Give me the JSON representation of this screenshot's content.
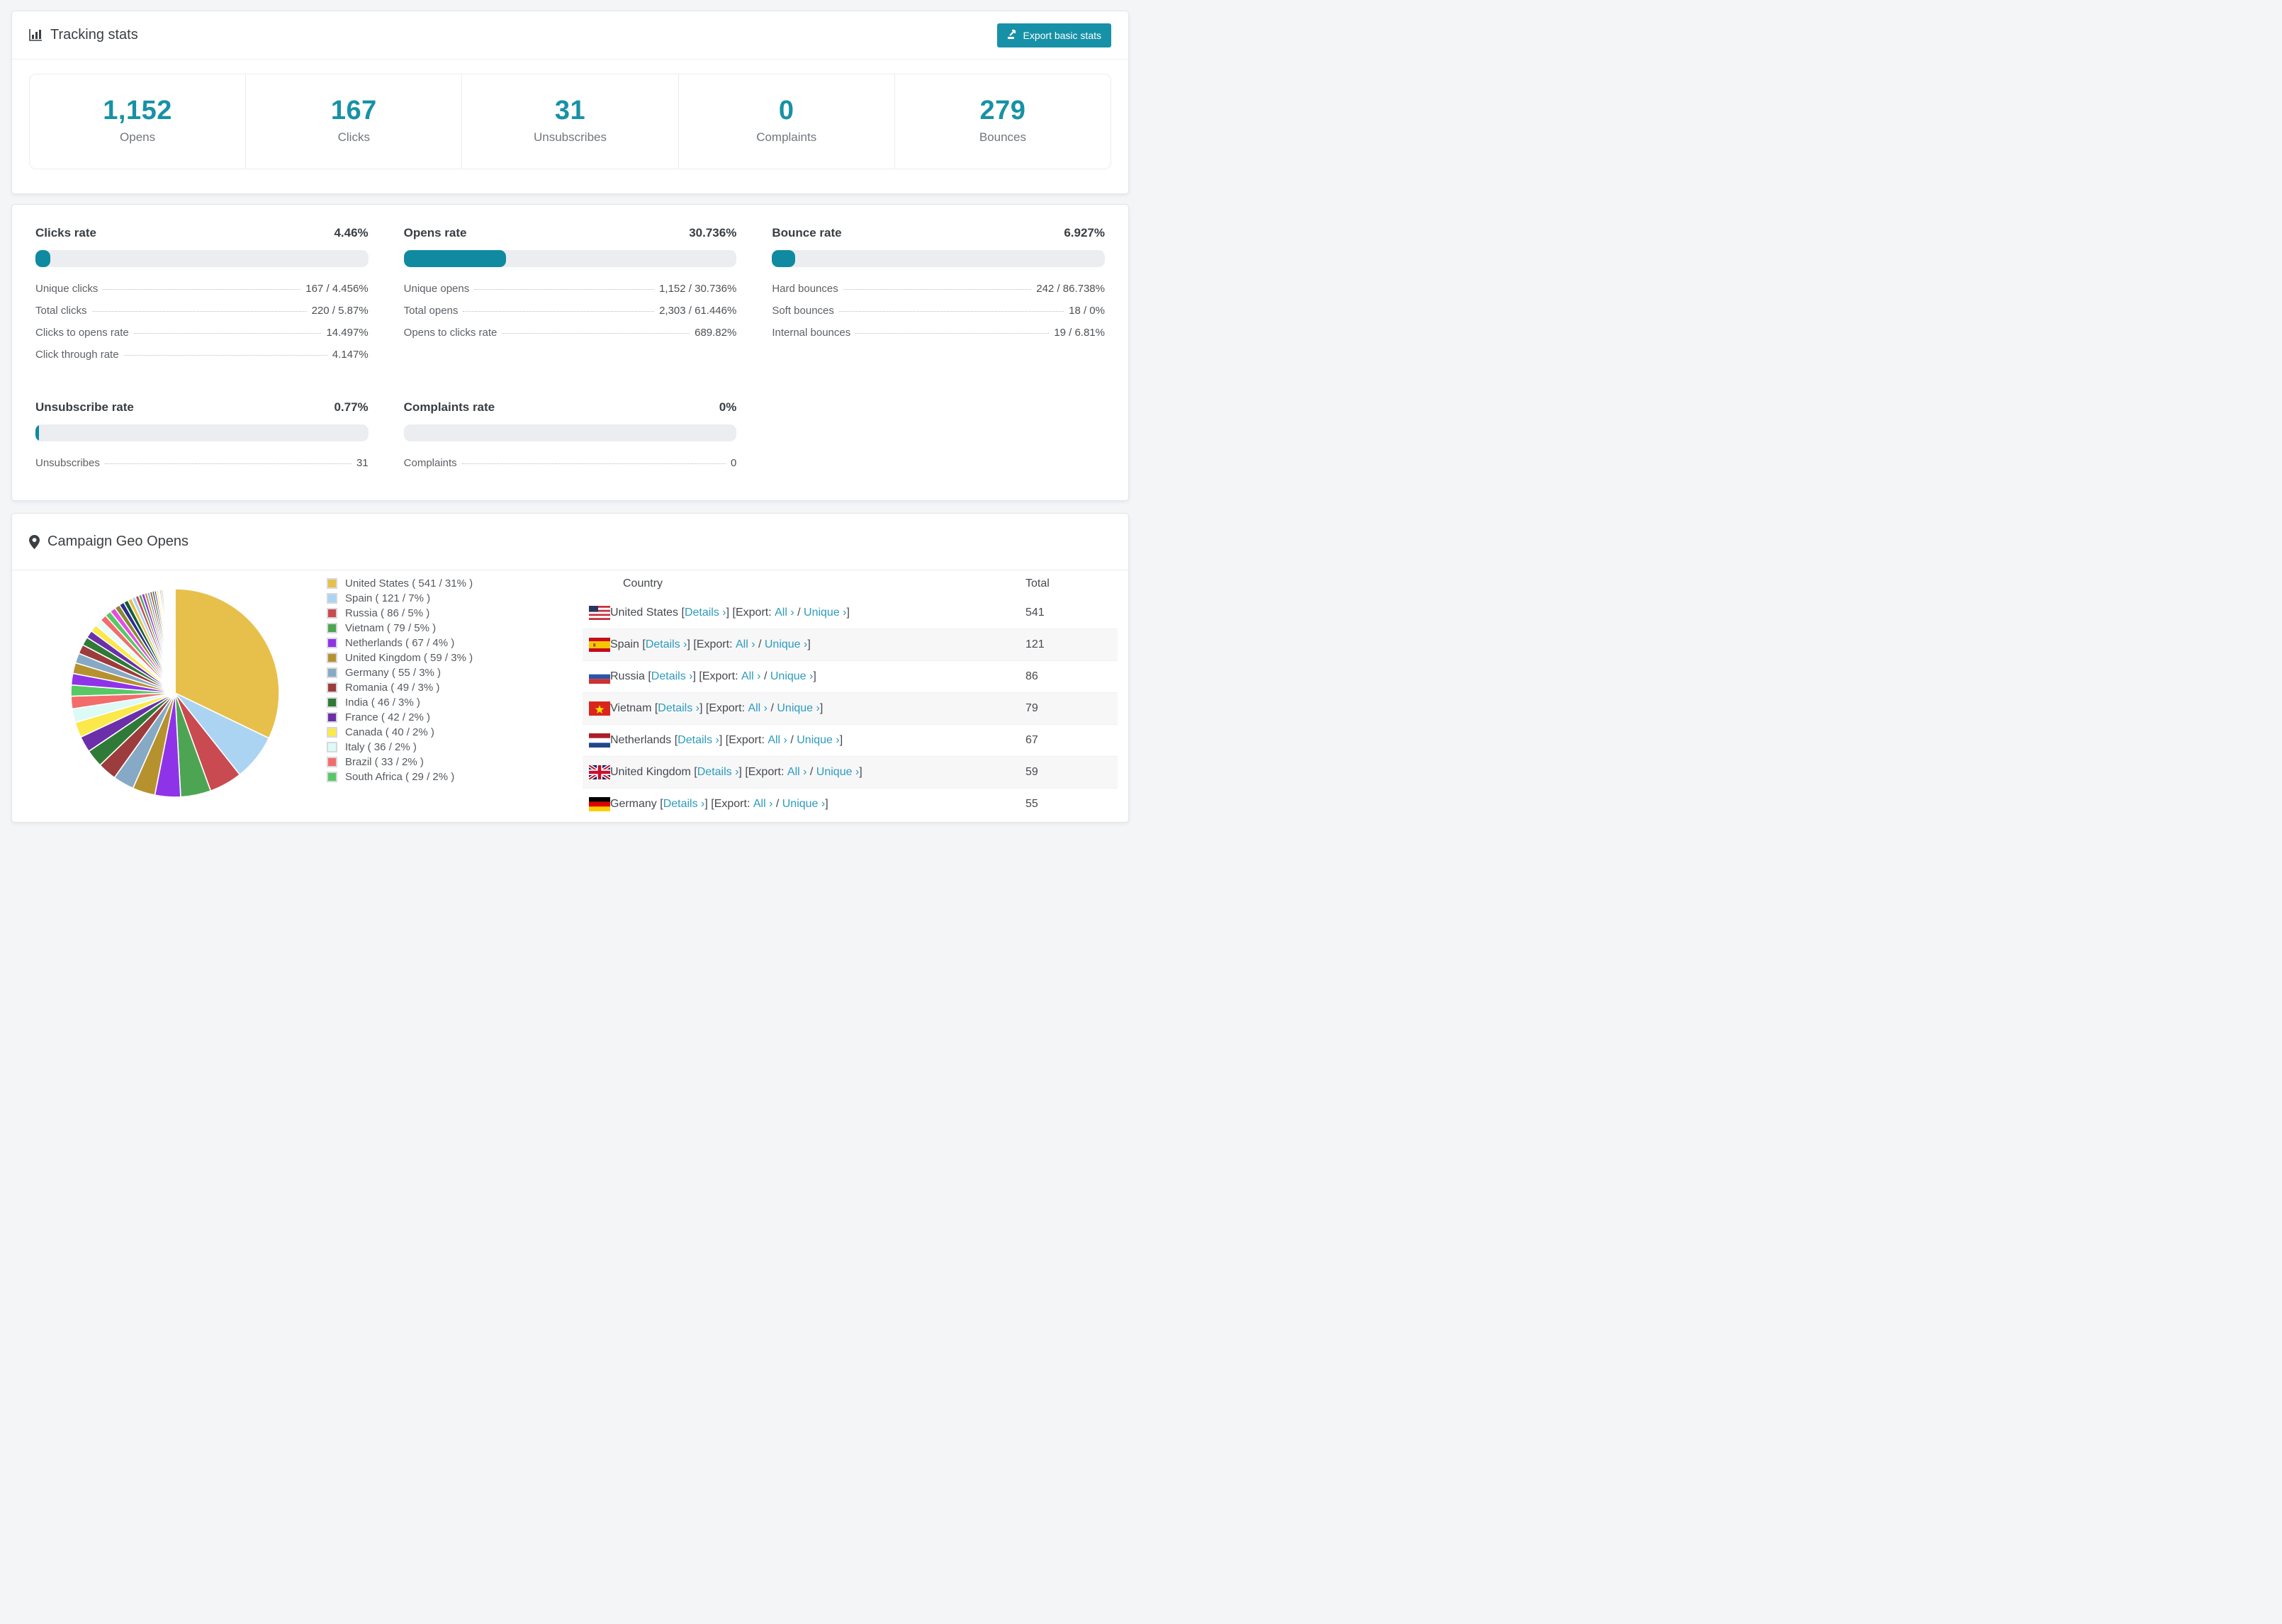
{
  "colors": {
    "accent": "#1791a7",
    "link": "#2c9bbf"
  },
  "tracking": {
    "title": "Tracking stats",
    "export_button": "Export basic stats",
    "stats": [
      {
        "value": "1,152",
        "label": "Opens"
      },
      {
        "value": "167",
        "label": "Clicks"
      },
      {
        "value": "31",
        "label": "Unsubscribes"
      },
      {
        "value": "0",
        "label": "Complaints"
      },
      {
        "value": "279",
        "label": "Bounces"
      }
    ]
  },
  "rates": {
    "clicks": {
      "title": "Clicks rate",
      "value": "4.46%",
      "percent": 4.46,
      "rows": [
        {
          "label": "Unique clicks",
          "value": "167 / 4.456%"
        },
        {
          "label": "Total clicks",
          "value": "220 / 5.87%"
        },
        {
          "label": "Clicks to opens rate",
          "value": "14.497%"
        },
        {
          "label": "Click through rate",
          "value": "4.147%"
        }
      ]
    },
    "opens": {
      "title": "Opens rate",
      "value": "30.736%",
      "percent": 30.736,
      "rows": [
        {
          "label": "Unique opens",
          "value": "1,152 / 30.736%"
        },
        {
          "label": "Total opens",
          "value": "2,303 / 61.446%"
        },
        {
          "label": "Opens to clicks rate",
          "value": "689.82%"
        }
      ]
    },
    "bounce": {
      "title": "Bounce rate",
      "value": "6.927%",
      "percent": 6.927,
      "rows": [
        {
          "label": "Hard bounces",
          "value": "242 / 86.738%"
        },
        {
          "label": "Soft bounces",
          "value": "18 / 0%"
        },
        {
          "label": "Internal bounces",
          "value": "19 / 6.81%"
        }
      ]
    },
    "unsubscribe": {
      "title": "Unsubscribe rate",
      "value": "0.77%",
      "percent": 0.77,
      "rows": [
        {
          "label": "Unsubscribes",
          "value": "31"
        }
      ]
    },
    "complaints": {
      "title": "Complaints rate",
      "value": "0%",
      "percent": 0,
      "rows": [
        {
          "label": "Complaints",
          "value": "0"
        }
      ]
    }
  },
  "geo": {
    "title": "Campaign Geo Opens",
    "table": {
      "headers": {
        "country": "Country",
        "total": "Total"
      },
      "labels": {
        "details": "Details ›",
        "export": "Export:",
        "all": "All ›",
        "unique": "Unique ›"
      },
      "rows": [
        {
          "country": "United States",
          "flag": "us",
          "total": "541"
        },
        {
          "country": "Spain",
          "flag": "es",
          "total": "121"
        },
        {
          "country": "Russia",
          "flag": "ru",
          "total": "86"
        },
        {
          "country": "Vietnam",
          "flag": "vn",
          "total": "79"
        },
        {
          "country": "Netherlands",
          "flag": "nl",
          "total": "67"
        },
        {
          "country": "United Kingdom",
          "flag": "gb",
          "total": "59"
        },
        {
          "country": "Germany",
          "flag": "de",
          "total": "55"
        }
      ]
    }
  },
  "chart_data": {
    "type": "pie",
    "title": "Campaign Geo Opens",
    "legend_position": "right",
    "slices": [
      {
        "label": "United States",
        "value": 541,
        "pct": "31%",
        "color": "#e7c04b"
      },
      {
        "label": "Spain",
        "value": 121,
        "pct": "7%",
        "color": "#abd4f3"
      },
      {
        "label": "Russia",
        "value": 86,
        "pct": "5%",
        "color": "#c94a50"
      },
      {
        "label": "Vietnam",
        "value": 79,
        "pct": "5%",
        "color": "#4da553"
      },
      {
        "label": "Netherlands",
        "value": 67,
        "pct": "4%",
        "color": "#8f33e8"
      },
      {
        "label": "United Kingdom",
        "value": 59,
        "pct": "3%",
        "color": "#b6922f"
      },
      {
        "label": "Germany",
        "value": 55,
        "pct": "3%",
        "color": "#86a9c5"
      },
      {
        "label": "Romania",
        "value": 49,
        "pct": "3%",
        "color": "#9d3c3c"
      },
      {
        "label": "India",
        "value": 46,
        "pct": "3%",
        "color": "#2f7a36"
      },
      {
        "label": "France",
        "value": 42,
        "pct": "2%",
        "color": "#6c2fa9"
      },
      {
        "label": "Canada",
        "value": 40,
        "pct": "2%",
        "color": "#fbe84a"
      },
      {
        "label": "Italy",
        "value": 36,
        "pct": "2%",
        "color": "#dcfaf6"
      },
      {
        "label": "Brazil",
        "value": 33,
        "pct": "2%",
        "color": "#f36c6c"
      },
      {
        "label": "South Africa",
        "value": 29,
        "pct": "2%",
        "color": "#57c865"
      }
    ],
    "other_values": [
      30,
      28,
      26,
      24,
      22,
      20,
      19,
      18,
      17,
      16,
      15,
      14,
      13,
      12,
      11,
      10,
      9,
      8,
      8,
      7,
      7,
      6,
      6,
      5,
      5,
      4,
      4,
      4,
      3,
      3,
      3,
      3,
      2,
      2,
      2,
      2,
      2,
      2,
      1,
      1,
      1,
      1,
      1,
      1,
      1,
      1
    ],
    "other_palette": [
      "#8f33e8",
      "#b6922f",
      "#86a9c5",
      "#9d3c3c",
      "#2f7a36",
      "#6c2fa9",
      "#fbe84a",
      "#e8fcf9",
      "#f36c6c",
      "#57c865",
      "#e44fe0",
      "#8a8a2e",
      "#2b2f8f",
      "#145c38",
      "#e7c04b",
      "#abd4f3",
      "#c94a50",
      "#4da553"
    ]
  }
}
